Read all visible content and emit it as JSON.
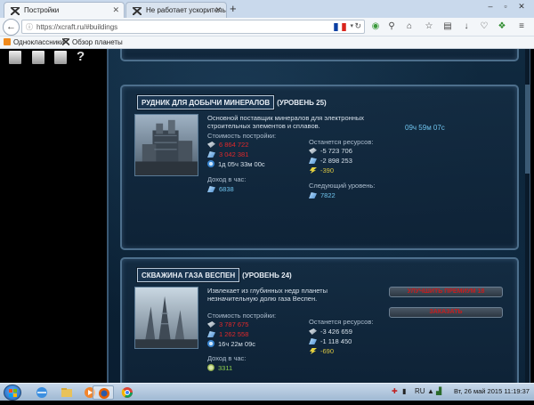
{
  "browser": {
    "tabs": [
      {
        "title": "Постройки",
        "active": true
      },
      {
        "title": "Не работает ускоритель ...",
        "active": false
      }
    ],
    "new_tab": "+",
    "url": "https://xcraft.ru/#buildings",
    "bookmarks": [
      {
        "label": "Одноклассники",
        "icon": "odnoklassniki-icon"
      },
      {
        "label": "Обзор планеты",
        "icon": "xcraft-icon"
      }
    ]
  },
  "page": {
    "help_glyph": "?",
    "buildings": [
      {
        "name": "РУДНИК ДЛЯ ДОБЫЧИ МИНЕРАЛОВ",
        "level": "(УРОВЕНЬ 25)",
        "description": "Основной поставщик минералов для электронных строительных элементов и сплавов.",
        "cost_label": "Стоимость постройки:",
        "cost": {
          "metal": "6 864 722",
          "crystal": "3 042 381",
          "time": "1д 05ч 33м 00с"
        },
        "income_label": "Доход в час:",
        "income": {
          "icon": "crystal-icon",
          "value": "6838"
        },
        "remaining_label": "Останется ресурсов:",
        "remaining": {
          "metal": "-5 723 706",
          "crystal": "-2 898 253",
          "energy": "-390"
        },
        "next_level_label": "Следующий уровень:",
        "next_level": {
          "icon": "crystal-icon",
          "value": "7822"
        },
        "timer": "09ч 59м 07с"
      },
      {
        "name": "СКВАЖИНА ГАЗА ВЕСПЕН",
        "level": "(УРОВЕНЬ 24)",
        "description": "Извлекает из глубинных недр планеты незначительную долю газа Веспен.",
        "cost_label": "Стоимость постройки:",
        "cost": {
          "metal": "3 787 675",
          "crystal": "1 262 558",
          "time": "16ч 22м 09с"
        },
        "income_label": "Доход в час:",
        "income": {
          "icon": "gas-icon",
          "value": "3311"
        },
        "remaining_label": "Останется ресурсов:",
        "remaining": {
          "metal": "-3 426 659",
          "crystal": "-1 118 450",
          "energy": "-690"
        },
        "actions": [
          "УЛУЧШИТЬ ПРЕМИУМ 18",
          "ЗАКАЗАТЬ"
        ]
      }
    ]
  },
  "taskbar": {
    "tray_lang": "RU",
    "clock": "Вт, 26 май 2015  11:19:37"
  }
}
